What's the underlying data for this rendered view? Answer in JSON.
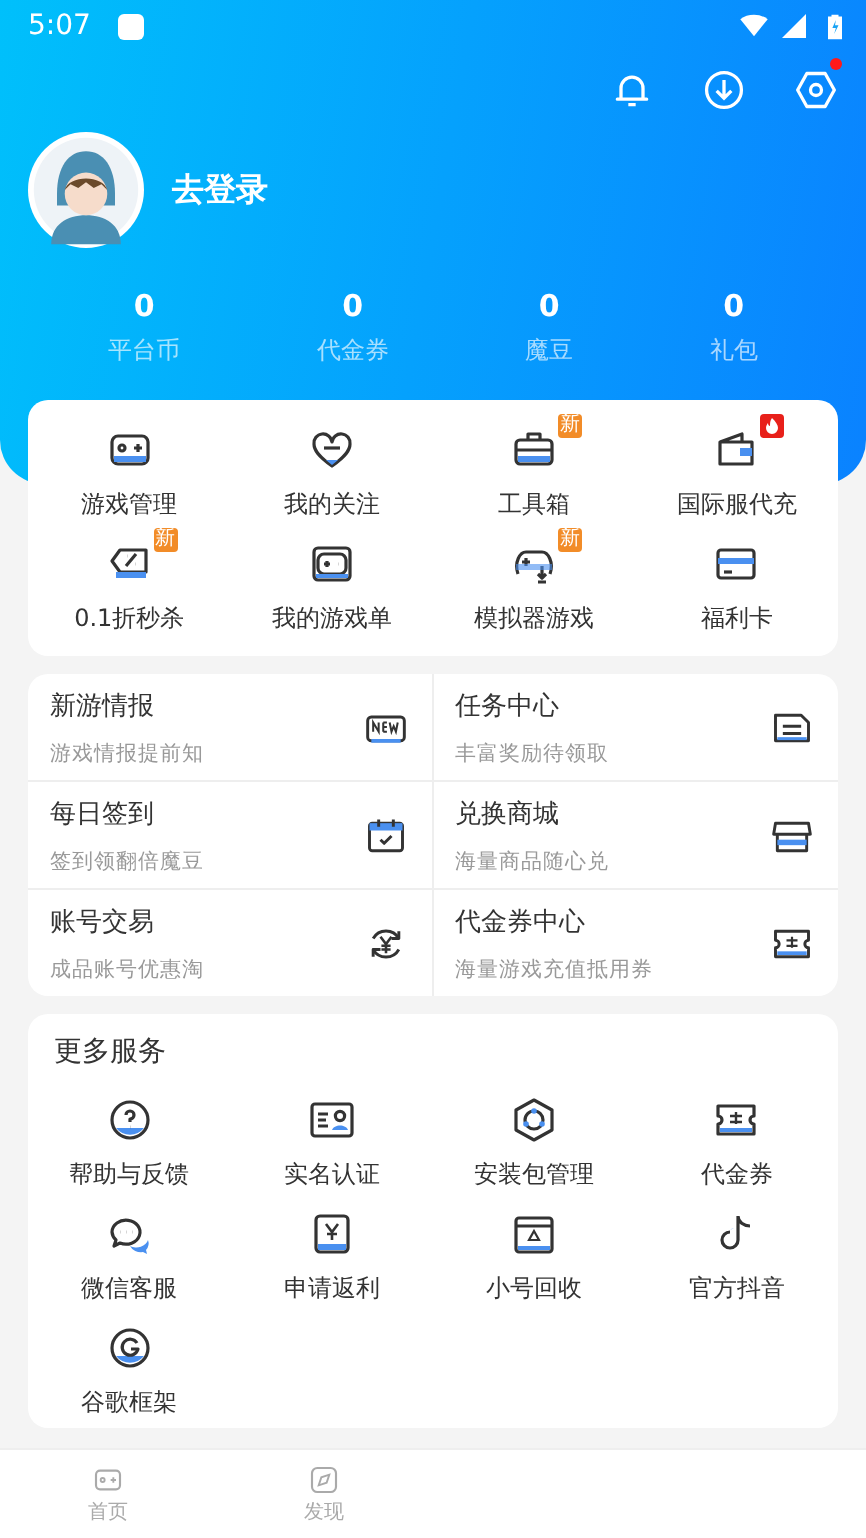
{
  "status_bar": {
    "time": "5:07"
  },
  "header": {
    "login": "去登录",
    "settings_dot": true
  },
  "stats": [
    {
      "value": "0",
      "label": "平台币"
    },
    {
      "value": "0",
      "label": "代金券"
    },
    {
      "value": "0",
      "label": "魔豆"
    },
    {
      "value": "0",
      "label": "礼包"
    }
  ],
  "quick_grid": [
    {
      "label": "游戏管理"
    },
    {
      "label": "我的关注"
    },
    {
      "label": "工具箱",
      "badge": {
        "kind": "new",
        "text": "新"
      }
    },
    {
      "label": "国际服代充",
      "badge": {
        "kind": "hot"
      }
    },
    {
      "label": "0.1折秒杀",
      "badge": {
        "kind": "new",
        "text": "新"
      }
    },
    {
      "label": "我的游戏单"
    },
    {
      "label": "模拟器游戏",
      "badge": {
        "kind": "new",
        "text": "新"
      }
    },
    {
      "label": "福利卡"
    }
  ],
  "features": [
    {
      "title": "新游情报",
      "subtitle": "游戏情报提前知"
    },
    {
      "title": "任务中心",
      "subtitle": "丰富奖励待领取"
    },
    {
      "title": "每日签到",
      "subtitle": "签到领翻倍魔豆"
    },
    {
      "title": "兑换商城",
      "subtitle": "海量商品随心兑"
    },
    {
      "title": "账号交易",
      "subtitle": "成品账号优惠淘"
    },
    {
      "title": "代金券中心",
      "subtitle": "海量游戏充值抵用券"
    }
  ],
  "more_services": {
    "title": "更多服务",
    "items": [
      {
        "label": "帮助与反馈"
      },
      {
        "label": "实名认证"
      },
      {
        "label": "安装包管理"
      },
      {
        "label": "代金券"
      },
      {
        "label": "微信客服"
      },
      {
        "label": "申请返利"
      },
      {
        "label": "小号回收"
      },
      {
        "label": "官方抖音"
      },
      {
        "label": "谷歌框架"
      }
    ]
  },
  "bottom_nav": [
    {
      "label": "首页"
    },
    {
      "label": "发现"
    }
  ]
}
